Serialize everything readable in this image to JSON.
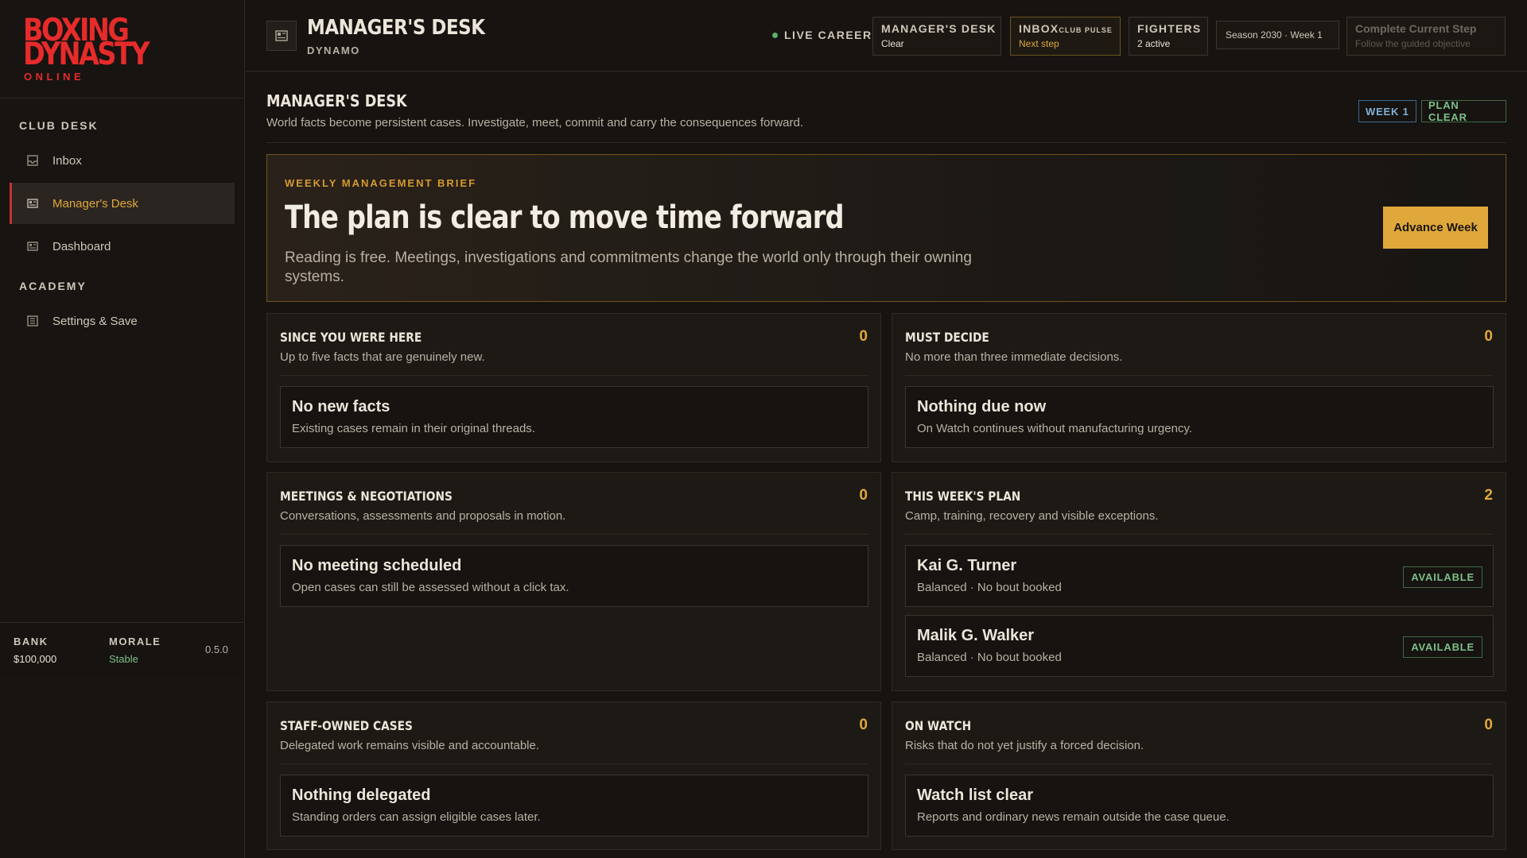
{
  "sidebar": {
    "logo_line1": "BOXING",
    "logo_line2": "DYNASTY",
    "logo_sub": "ONLINE",
    "section_club": "CLUB DESK",
    "section_academy": "ACADEMY",
    "items": [
      {
        "label": "Inbox",
        "icon": "inbox-icon"
      },
      {
        "label": "Manager's Desk",
        "icon": "desk-icon",
        "active": true
      },
      {
        "label": "Dashboard",
        "icon": "dashboard-icon"
      },
      {
        "label": "Settings & Save",
        "icon": "settings-icon"
      }
    ],
    "footer": {
      "bank_label": "BANK",
      "bank_value": "$100,000",
      "morale_label": "MORALE",
      "morale_value": "Stable",
      "version": "0.5.0"
    }
  },
  "topbar": {
    "title": "MANAGER'S DESK",
    "subtitle": "DYNAMO",
    "live": "LIVE CAREER",
    "chips": {
      "desk_label": "MANAGER'S DESK",
      "desk_value": "Clear",
      "inbox_label": "INBOX",
      "inbox_small": "CLUB PULSE",
      "inbox_value": "Next step",
      "fighters_label": "FIGHTERS",
      "fighters_value": "2 active",
      "season": "Season 2030 · Week 1",
      "step_label": "Complete Current Step",
      "step_value": "Follow the guided objective"
    }
  },
  "page": {
    "title": "MANAGER'S DESK",
    "subtitle": "World facts become persistent cases. Investigate, meet, commit and carry the consequences forward.",
    "tag_week": "WEEK 1",
    "tag_plan": "PLAN CLEAR"
  },
  "brief": {
    "kicker": "WEEKLY MANAGEMENT BRIEF",
    "title": "The plan is clear to move time forward",
    "text": "Reading is free. Meetings, investigations and commitments change the world only through their owning systems.",
    "button": "Advance Week"
  },
  "cards": {
    "since": {
      "title": "SINCE YOU WERE HERE",
      "sub": "Up to five facts that are genuinely new.",
      "count": "0",
      "item_title": "No new facts",
      "item_sub": "Existing cases remain in their original threads."
    },
    "decide": {
      "title": "MUST DECIDE",
      "sub": "No more than three immediate decisions.",
      "count": "0",
      "item_title": "Nothing due now",
      "item_sub": "On Watch continues without manufacturing urgency."
    },
    "meetings": {
      "title": "MEETINGS & NEGOTIATIONS",
      "sub": "Conversations, assessments and proposals in motion.",
      "count": "0",
      "item_title": "No meeting scheduled",
      "item_sub": "Open cases can still be assessed without a click tax."
    },
    "plan": {
      "title": "THIS WEEK'S PLAN",
      "sub": "Camp, training, recovery and visible exceptions.",
      "count": "2",
      "fighters": [
        {
          "name": "Kai G. Turner",
          "detail": "Balanced · No bout booked",
          "status": "AVAILABLE"
        },
        {
          "name": "Malik G. Walker",
          "detail": "Balanced · No bout booked",
          "status": "AVAILABLE"
        }
      ]
    },
    "staff": {
      "title": "STAFF-OWNED CASES",
      "sub": "Delegated work remains visible and accountable.",
      "count": "0",
      "item_title": "Nothing delegated",
      "item_sub": "Standing orders can assign eligible cases later."
    },
    "watch": {
      "title": "ON WATCH",
      "sub": "Risks that do not yet justify a forced decision.",
      "count": "0",
      "item_title": "Watch list clear",
      "item_sub": "Reports and ordinary news remain outside the case queue."
    }
  }
}
